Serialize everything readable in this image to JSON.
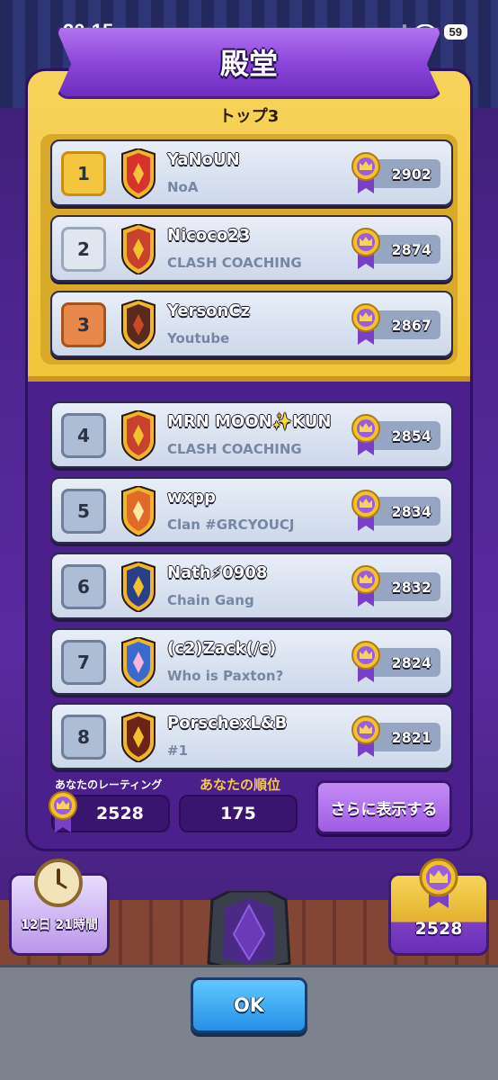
{
  "status_bar": {
    "time": "20:15",
    "battery": "59"
  },
  "screen": {
    "title": "殿堂",
    "top3_title": "トップ3"
  },
  "players": [
    {
      "rank": "1",
      "name": "YaNoUN",
      "clan": "NoA",
      "trophies": "2902",
      "rank_style": "gold",
      "badge_color": "#d8322e",
      "badge_accent": "#f5c13e",
      "badge_icon": "lightning-icon"
    },
    {
      "rank": "2",
      "name": "Nicoco23",
      "clan": "CLASH COACHING",
      "trophies": "2874",
      "rank_style": "silver",
      "badge_color": "#c8402e",
      "badge_accent": "#f2c22a",
      "badge_icon": "flag-stripes-icon"
    },
    {
      "rank": "3",
      "name": "YersonCz",
      "clan": "Youtube",
      "trophies": "2867",
      "rank_style": "bronze",
      "badge_color": "#5a2a1e",
      "badge_accent": "#c84a2a",
      "badge_icon": "hammer-icon"
    },
    {
      "rank": "4",
      "name": "MRN MOON✨KUN",
      "clan": "CLASH COACHING",
      "trophies": "2854",
      "rank_style": "normal",
      "badge_color": "#c8402e",
      "badge_accent": "#f2c22a",
      "badge_icon": "flag-stripes-icon"
    },
    {
      "rank": "5",
      "name": "wxpp",
      "clan": "Clan #GRCYOUCJ",
      "trophies": "2834",
      "rank_style": "normal",
      "badge_color": "#e06a2a",
      "badge_accent": "#ffe8a0",
      "badge_icon": "star-burst-icon"
    },
    {
      "rank": "6",
      "name": "Nath⚡0908",
      "clan": "Chain Gang",
      "trophies": "2832",
      "rank_style": "normal",
      "badge_color": "#2a3f8a",
      "badge_accent": "#f2c22a",
      "badge_icon": "lightning-icon"
    },
    {
      "rank": "7",
      "name": "(c2)Zack(/c)",
      "clan": "Who is Paxton?",
      "trophies": "2824",
      "rank_style": "normal",
      "badge_color": "#3a6ad0",
      "badge_accent": "#f7b6d8",
      "badge_icon": "flower-icon"
    },
    {
      "rank": "8",
      "name": "PorschexL&B",
      "clan": "#1",
      "trophies": "2821",
      "rank_style": "normal",
      "badge_color": "#6a2418",
      "badge_accent": "#f2c22a",
      "badge_icon": "star-icon"
    }
  ],
  "your_stats": {
    "rating_label": "あなたのレーティング",
    "rating_value": "2528",
    "rank_label": "あなたの順位",
    "rank_value": "175",
    "more_button": "さらに表示する"
  },
  "bottom": {
    "timer_text": "12日 21時間",
    "season_trophies": "2528",
    "ok_button": "OK"
  },
  "colors": {
    "panel_purple": "#4b1f8c",
    "top3_gold": "#f2c63a",
    "ok_blue": "#2590e6"
  }
}
